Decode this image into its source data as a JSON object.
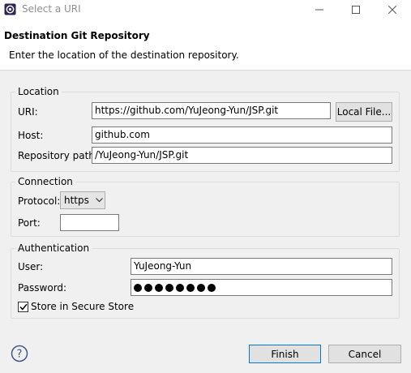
{
  "window": {
    "title": "Select a URI"
  },
  "header": {
    "title": "Destination Git Repository",
    "description": "Enter the location of the destination repository."
  },
  "location": {
    "group_label": "Location",
    "uri_label": "URI:",
    "uri_value": "https://github.com/YuJeong-Yun/JSP.git",
    "local_file_button": "Local File...",
    "host_label": "Host:",
    "host_value": "github.com",
    "path_label": "Repository path:",
    "path_value": "/YuJeong-Yun/JSP.git"
  },
  "connection": {
    "group_label": "Connection",
    "protocol_label": "Protocol:",
    "protocol_value": "https",
    "port_label": "Port:",
    "port_value": ""
  },
  "authentication": {
    "group_label": "Authentication",
    "user_label": "User:",
    "user_value": "YuJeong-Yun",
    "password_label": "Password:",
    "password_mask_count": 8,
    "store_label": "Store in Secure Store",
    "store_checked": true
  },
  "footer": {
    "finish_label": "Finish",
    "cancel_label": "Cancel"
  },
  "colors": {
    "dialog_bg": "#f0f0f0",
    "header_bg": "#ffffff",
    "primary_border": "#0078d7",
    "help_icon": "#3b5a88"
  },
  "icons": [
    "eclipse-app-icon",
    "minimize-icon",
    "maximize-icon",
    "close-icon",
    "chevron-down-icon",
    "checkmark-icon",
    "help-icon"
  ]
}
